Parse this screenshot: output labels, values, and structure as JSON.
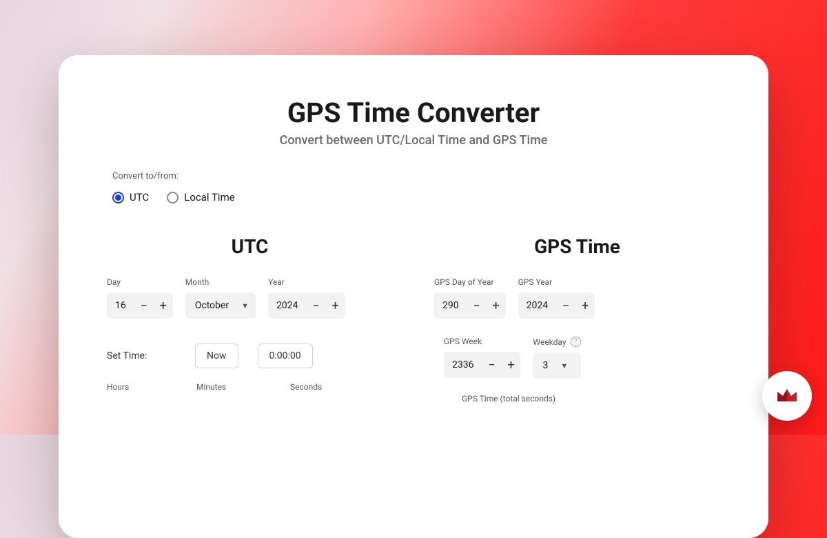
{
  "header": {
    "title": "GPS Time Converter",
    "subtitle": "Convert between UTC/Local Time and GPS Time"
  },
  "convert": {
    "label": "Convert to/from:",
    "options": {
      "utc": "UTC",
      "local": "Local Time"
    }
  },
  "utc": {
    "title": "UTC",
    "labels": {
      "day": "Day",
      "month": "Month",
      "year": "Year",
      "setTime": "Set Time:",
      "hours": "Hours",
      "minutes": "Minutes",
      "seconds": "Seconds"
    },
    "values": {
      "day": "16",
      "month": "October",
      "year": "2024"
    },
    "buttons": {
      "now": "Now",
      "zero": "0:00:00"
    }
  },
  "gps": {
    "title": "GPS Time",
    "labels": {
      "dayOfYear": "GPS Day of Year",
      "year": "GPS Year",
      "week": "GPS Week",
      "weekday": "Weekday",
      "totalSeconds": "GPS Time (total seconds)"
    },
    "values": {
      "dayOfYear": "290",
      "year": "2024",
      "week": "2336",
      "weekday": "3"
    }
  },
  "glyphs": {
    "minus": "−",
    "plus": "+",
    "caret": "▼",
    "help": "?"
  }
}
